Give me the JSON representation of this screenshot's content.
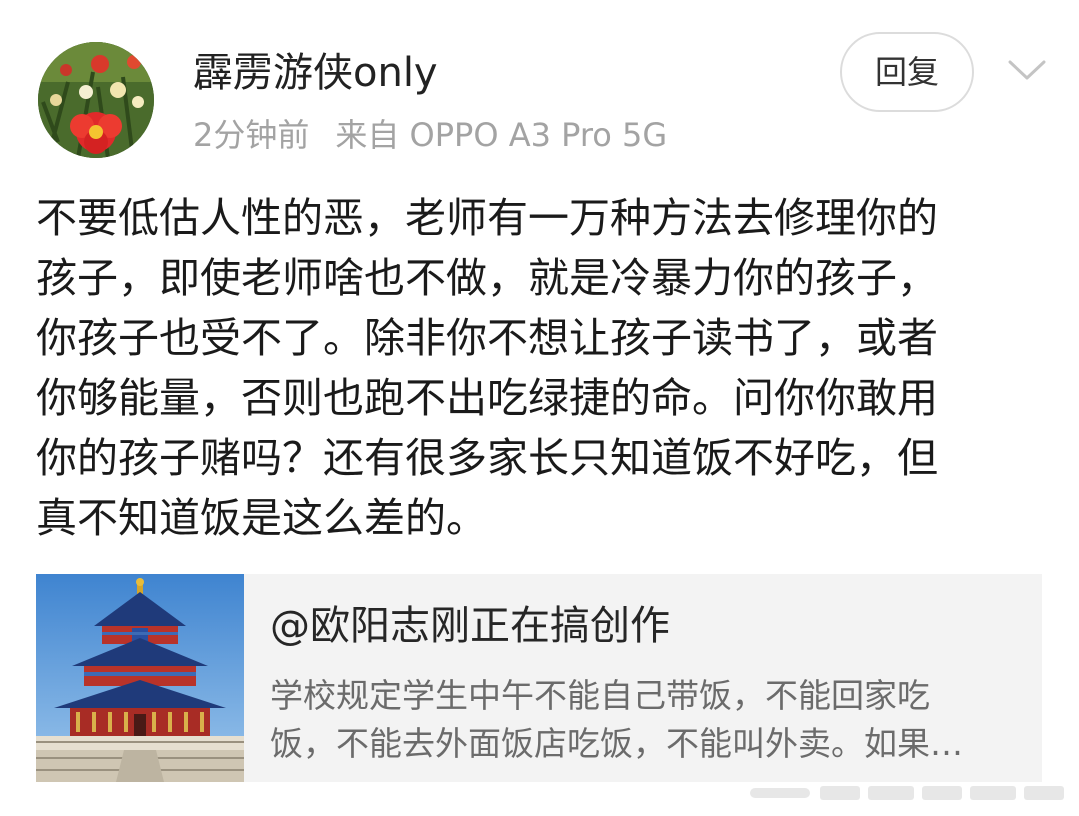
{
  "comment": {
    "author": "霹雳游侠only",
    "time": "2分钟前",
    "source": "来自 OPPO A3 Pro 5G",
    "reply_label": "回复",
    "menu_icon": "chevron-down-icon",
    "avatar": "flower-avatar",
    "text_lines": [
      "不要低估人性的恶，老师有一万种方法去修理你的",
      "孩子，即使老师啥也不做，就是冷暴力你的孩子，",
      "你孩子也受不了。除非你不想让孩子读书了，或者",
      "你够能量，否则也跑不出吃绿捷的命。问你你敢用",
      "你的孩子赌吗？还有很多家长只知道饭不好吃，但",
      "真不知道饭是这么差的。"
    ]
  },
  "quoted_post": {
    "author": "@欧阳志刚正在搞创作",
    "thumbnail": "temple-of-heaven-image",
    "excerpt_lines": [
      "学校规定学生中午不能自己带饭，不能回家吃",
      "饭，不能去外面饭店吃饭，不能叫外卖。如果…"
    ]
  },
  "colors": {
    "text": "#1a1a1a",
    "meta": "#a3a3a3",
    "card_bg": "#f3f3f3",
    "excerpt": "#6b6b6b",
    "border": "#dcdcdc"
  }
}
